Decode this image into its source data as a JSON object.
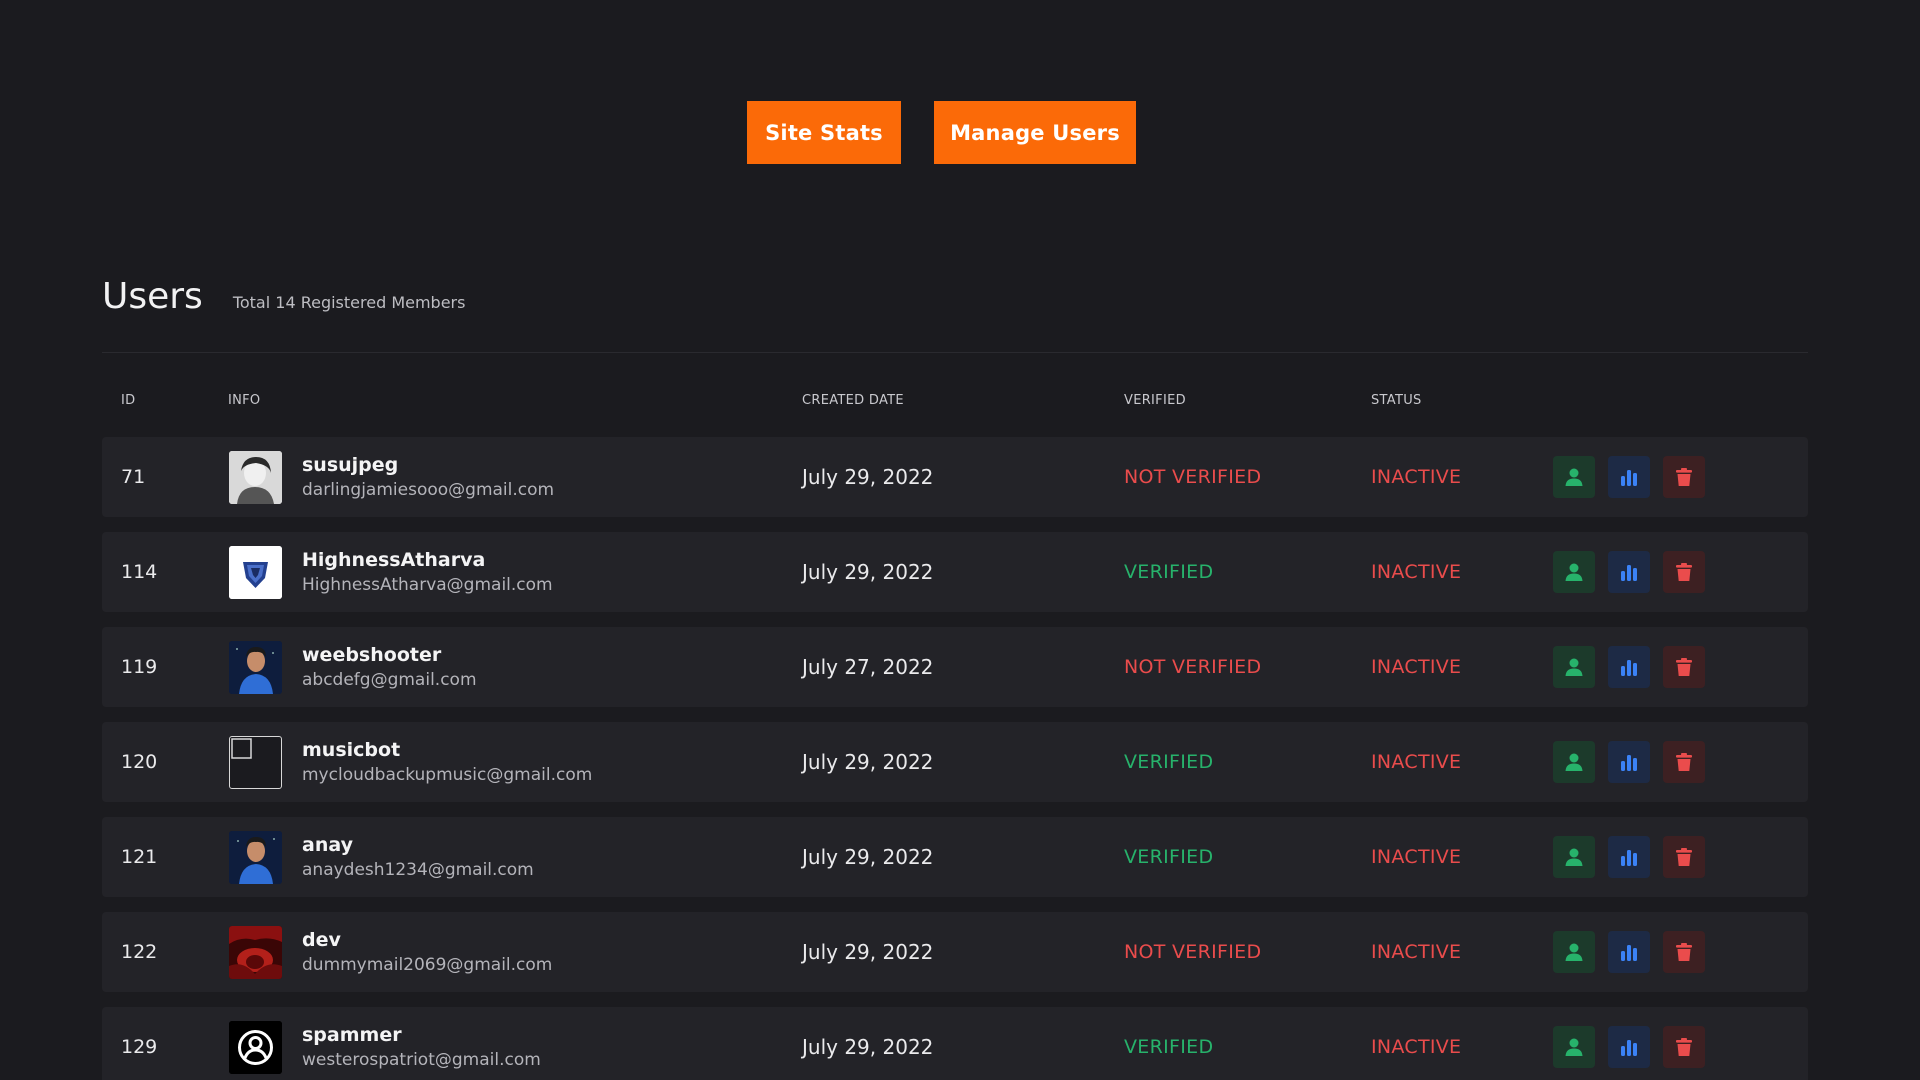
{
  "top_buttons": {
    "site_stats": "Site Stats",
    "manage_users": "Manage Users"
  },
  "users_section": {
    "title": "Users",
    "subtitle": "Total 14 Registered Members"
  },
  "table": {
    "headers": {
      "id": "ID",
      "info": "INFO",
      "created_date": "CREATED DATE",
      "verified": "VERIFIED",
      "status": "STATUS"
    },
    "rows": [
      {
        "id": "71",
        "username": "susujpeg",
        "email": "darlingjamiesooo@gmail.com",
        "created": "July 29, 2022",
        "verified": "NOT VERIFIED",
        "status": "INACTIVE"
      },
      {
        "id": "114",
        "username": "HighnessAtharva",
        "email": "HighnessAtharva@gmail.com",
        "created": "July 29, 2022",
        "verified": "VERIFIED",
        "status": "INACTIVE"
      },
      {
        "id": "119",
        "username": "weebshooter",
        "email": "abcdefg@gmail.com",
        "created": "July 27, 2022",
        "verified": "NOT VERIFIED",
        "status": "INACTIVE"
      },
      {
        "id": "120",
        "username": "musicbot",
        "email": "mycloudbackupmusic@gmail.com",
        "created": "July 29, 2022",
        "verified": "VERIFIED",
        "status": "INACTIVE"
      },
      {
        "id": "121",
        "username": "anay",
        "email": "anaydesh1234@gmail.com",
        "created": "July 29, 2022",
        "verified": "VERIFIED",
        "status": "INACTIVE"
      },
      {
        "id": "122",
        "username": "dev",
        "email": "dummymail2069@gmail.com",
        "created": "July 29, 2022",
        "verified": "NOT VERIFIED",
        "status": "INACTIVE"
      },
      {
        "id": "129",
        "username": "spammer",
        "email": "westerospatriot@gmail.com",
        "created": "July 29, 2022",
        "verified": "VERIFIED",
        "status": "INACTIVE"
      }
    ]
  },
  "icons": {
    "view_user": "user-icon",
    "stats": "bar-chart-icon",
    "delete": "trash-icon"
  },
  "colors": {
    "accent": "#fb6a08",
    "verified": "#27b26b",
    "not_verified": "#ea4c4c",
    "inactive": "#ea4c4c",
    "stats_icon": "#3b82f6"
  }
}
